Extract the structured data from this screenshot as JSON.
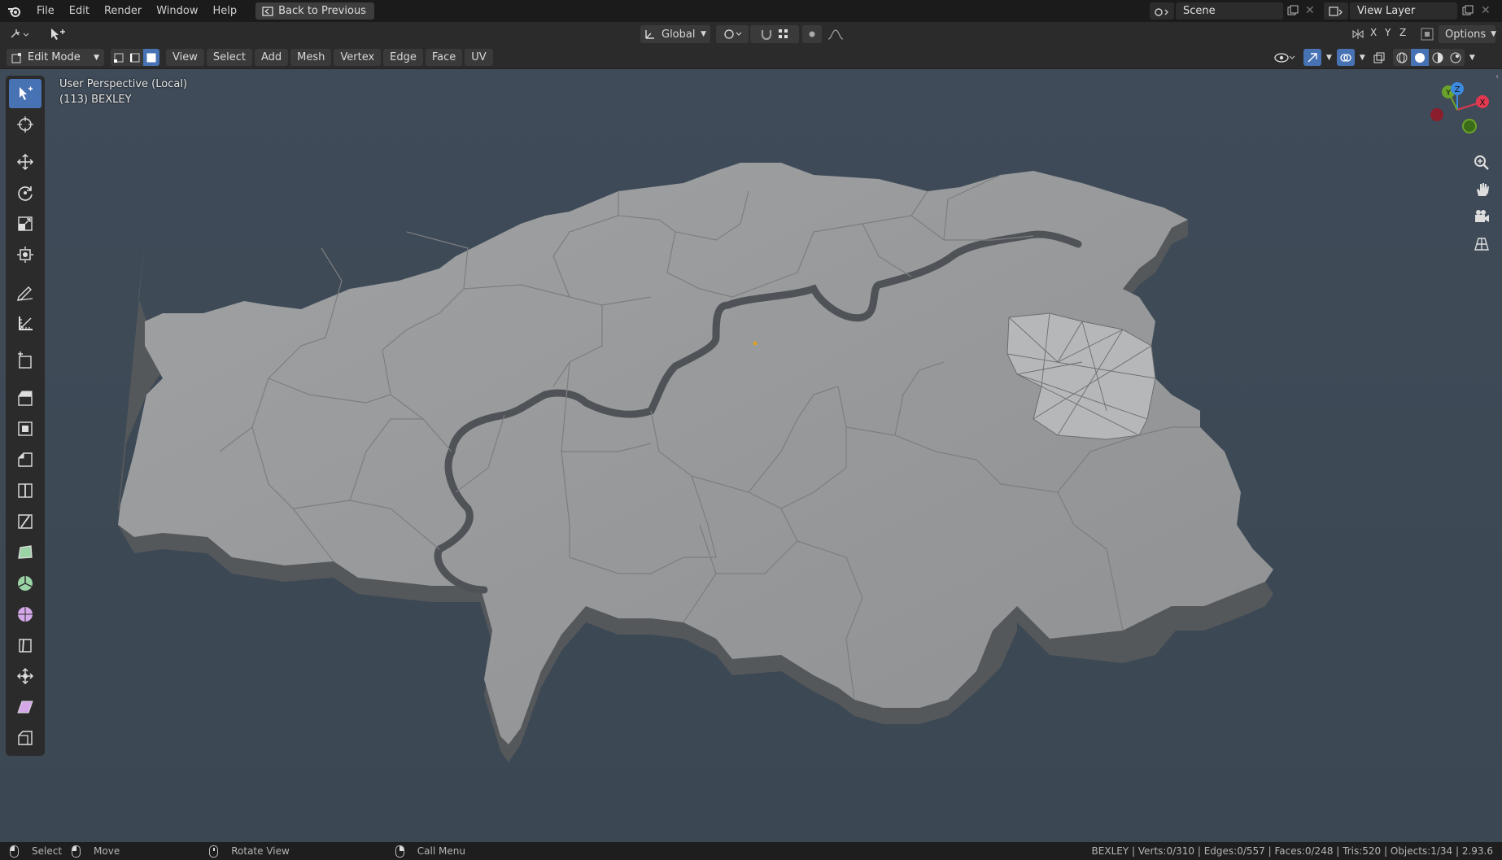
{
  "menubar": {
    "items": [
      "File",
      "Edit",
      "Render",
      "Window",
      "Help"
    ],
    "back_button": "Back to Previous",
    "scene_label": "Scene",
    "view_layer_label": "View Layer"
  },
  "tool_settings": {
    "orientation": "Global",
    "axes": [
      "X",
      "Y",
      "Z"
    ],
    "options_label": "Options"
  },
  "header": {
    "mode": "Edit Mode",
    "menus": [
      "View",
      "Select",
      "Add",
      "Mesh",
      "Vertex",
      "Edge",
      "Face",
      "UV"
    ]
  },
  "viewport": {
    "perspective": "User Perspective (Local)",
    "object_info": "(113) BEXLEY",
    "background_color": "#3e4a56",
    "mesh_color": "#9a9c9e"
  },
  "gizmo": {
    "axes": [
      "Y",
      "Z",
      "X"
    ],
    "colors": {
      "x": "#e0384f",
      "y": "#6ba32a",
      "z": "#3c8ae0"
    }
  },
  "left_tools": [
    "select-box",
    "cursor",
    "move",
    "rotate",
    "scale",
    "transform",
    "annotate",
    "measure",
    "add-cube",
    "extrude",
    "inset",
    "bevel",
    "loop-cut",
    "knife",
    "poly-build",
    "spin",
    "smooth",
    "edge-slide",
    "shrink-fatten",
    "shear",
    "rip"
  ],
  "status": {
    "select_label": "Select",
    "move_label": "Move",
    "rotate_label": "Rotate View",
    "menu_label": "Call Menu",
    "stats": "BEXLEY | Verts:0/310 | Edges:0/557 | Faces:0/248 | Tris:520 | Objects:1/34 | 2.93.6"
  }
}
